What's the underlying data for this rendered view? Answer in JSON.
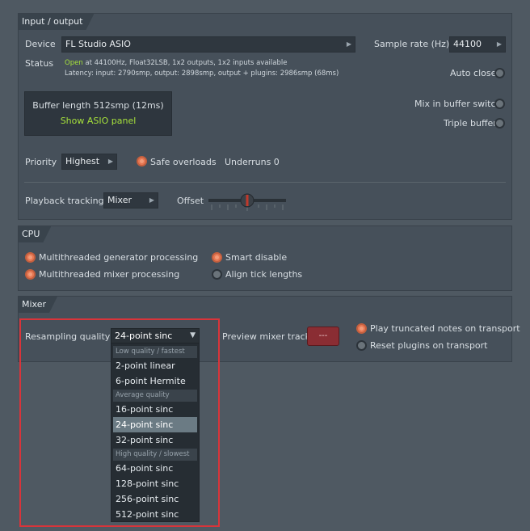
{
  "io": {
    "title": "Input / output",
    "device_label": "Device",
    "device_value": "FL Studio ASIO",
    "sample_rate_label": "Sample rate (Hz)",
    "sample_rate_value": "44100",
    "status_label": "Status",
    "status_open": "Open",
    "status_line1": "at 44100Hz, Float32LSB, 1x2 outputs, 1x2 inputs available",
    "status_line2": "Latency: input: 2790smp, output: 2898smp, output + plugins: 2986smp (68ms)",
    "auto_close": "Auto close",
    "buffer_length": "Buffer length 512smp (12ms)",
    "show_asio": "Show ASIO panel",
    "mix_in_buffer": "Mix in buffer switch",
    "triple_buffer": "Triple buffer",
    "priority_label": "Priority",
    "priority_value": "Highest",
    "safe_overloads": "Safe overloads",
    "underruns": "Underruns 0",
    "playback_tracking_label": "Playback tracking",
    "playback_tracking_value": "Mixer",
    "offset_label": "Offset"
  },
  "cpu": {
    "title": "CPU",
    "mt_generator": "Multithreaded generator processing",
    "mt_mixer": "Multithreaded mixer processing",
    "smart_disable": "Smart disable",
    "align_tick": "Align tick lengths"
  },
  "mixer": {
    "title": "Mixer",
    "resampling_label": "Resampling quality",
    "resampling_value": "24-point sinc",
    "preview_track_label": "Preview mixer track",
    "preview_track_value": "---",
    "play_truncated": "Play truncated notes on transport",
    "reset_plugins": "Reset plugins on transport"
  },
  "dropdown": {
    "header_low": "Low quality / fastest",
    "item_2linear": "2-point linear",
    "item_6hermite": "6-point Hermite",
    "header_avg": "Average quality",
    "item_16sinc": "16-point sinc",
    "item_24sinc": "24-point sinc",
    "item_32sinc": "32-point sinc",
    "header_high": "High quality / slowest",
    "item_64sinc": "64-point sinc",
    "item_128sinc": "128-point sinc",
    "item_256sinc": "256-point sinc",
    "item_512sinc": "512-point sinc"
  },
  "colors": {
    "accent_green": "#a6e13b",
    "radio_on": "#f29b79",
    "highlight": "#d9343a"
  },
  "icons": {
    "dropdown_arrow": "triangle-right",
    "select_arrow": "triangle-down"
  }
}
